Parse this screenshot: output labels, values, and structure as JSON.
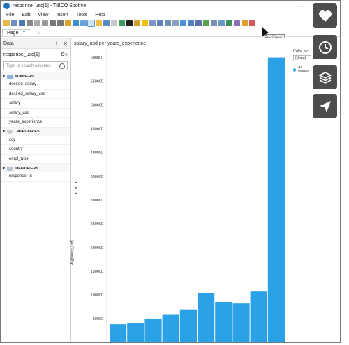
{
  "window": {
    "title": "response_usd[1] - TIBCO Spotfire",
    "controls": [
      "—",
      "☐",
      "✕"
    ]
  },
  "menubar": [
    "File",
    "Edit",
    "View",
    "Insert",
    "Tools",
    "Help"
  ],
  "tooltip": "Pie Chart",
  "tabs": {
    "page_label": "Page",
    "close": "×",
    "add": "+"
  },
  "panel": {
    "title": "Data",
    "pin_icon": "pin-icon",
    "close_icon": "close-icon",
    "table_name": "response_usd[1]",
    "search_placeholder": "Type to search columns",
    "groups": [
      {
        "label": "NUMBERS",
        "icon": "numbers-icon",
        "items": [
          "desired_salary",
          "desired_salary_usd",
          "salary",
          "salary_usd",
          "years_experience"
        ]
      },
      {
        "label": "CATEGORIES",
        "icon": "categories-icon",
        "items": [
          "ccy",
          "country",
          "empl_type"
        ]
      },
      {
        "label": "IDENTIFIERS",
        "icon": "identifiers-icon",
        "items": [
          "response_id"
        ]
      }
    ]
  },
  "visualization": {
    "title": "salary_usd per years_experience",
    "y_axis_label": "Avg(salary_usd)",
    "legend": {
      "title": "Color by:",
      "selector": "(None)",
      "entry": "All values"
    }
  },
  "colors": {
    "bar": "#2ba1e8",
    "accent": "#1e73be"
  },
  "chart_data": {
    "type": "bar",
    "title": "salary_usd per years_experience",
    "xlabel": "",
    "ylabel": "Avg(salary_usd)",
    "ylim": [
      0,
      620000
    ],
    "yticks": [
      50000,
      100000,
      150000,
      200000,
      250000,
      300000,
      350000,
      400000,
      450000,
      500000,
      550000,
      600000
    ],
    "values": [
      38000,
      40000,
      50000,
      58000,
      68000,
      103000,
      84000,
      82000,
      107000,
      600000
    ],
    "grid": false,
    "legend": "top-right"
  }
}
